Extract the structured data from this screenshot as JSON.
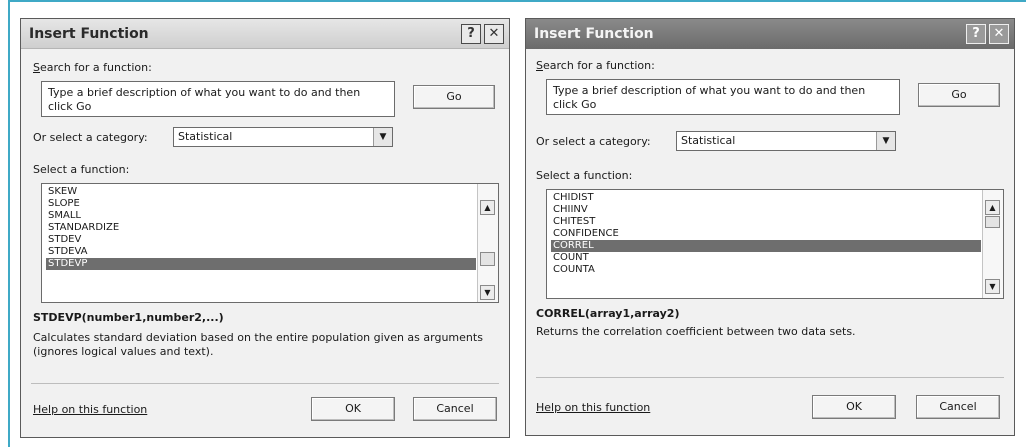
{
  "left_dialog": {
    "title": "Insert Function",
    "help_button": "?",
    "close_button": "✕",
    "search_label_accel": "S",
    "search_label_rest": "earch for a function:",
    "search_text": "Type a brief description of what you want to do and then click Go",
    "go_button": "Go",
    "category_label": "Or select a category:",
    "category_value": "Statistical",
    "select_label": "Select a function:",
    "functions": [
      "SKEW",
      "SLOPE",
      "SMALL",
      "STANDARDIZE",
      "STDEV",
      "STDEVA",
      "STDEVP"
    ],
    "selected_index": 6,
    "signature": "STDEVP(number1,number2,...)",
    "description": "Calculates standard deviation based on the entire population given as arguments (ignores logical values and text).",
    "help_link": "Help on this function",
    "ok_button": "OK",
    "cancel_button": "Cancel"
  },
  "right_dialog": {
    "title": "Insert Function",
    "help_button": "?",
    "close_button": "✕",
    "search_label_accel": "S",
    "search_label_rest": "earch for a function:",
    "search_text": "Type a brief description of what you want to do and then click Go",
    "go_button": "Go",
    "category_label": "Or select a category:",
    "category_value": "Statistical",
    "select_label": "Select a function:",
    "functions": [
      "CHIDIST",
      "CHIINV",
      "CHITEST",
      "CONFIDENCE",
      "CORREL",
      "COUNT",
      "COUNTA"
    ],
    "selected_index": 4,
    "signature": "CORREL(array1,array2)",
    "description": "Returns the correlation coefficient between two data sets.",
    "help_link": "Help on this function",
    "ok_button": "OK",
    "cancel_button": "Cancel"
  }
}
